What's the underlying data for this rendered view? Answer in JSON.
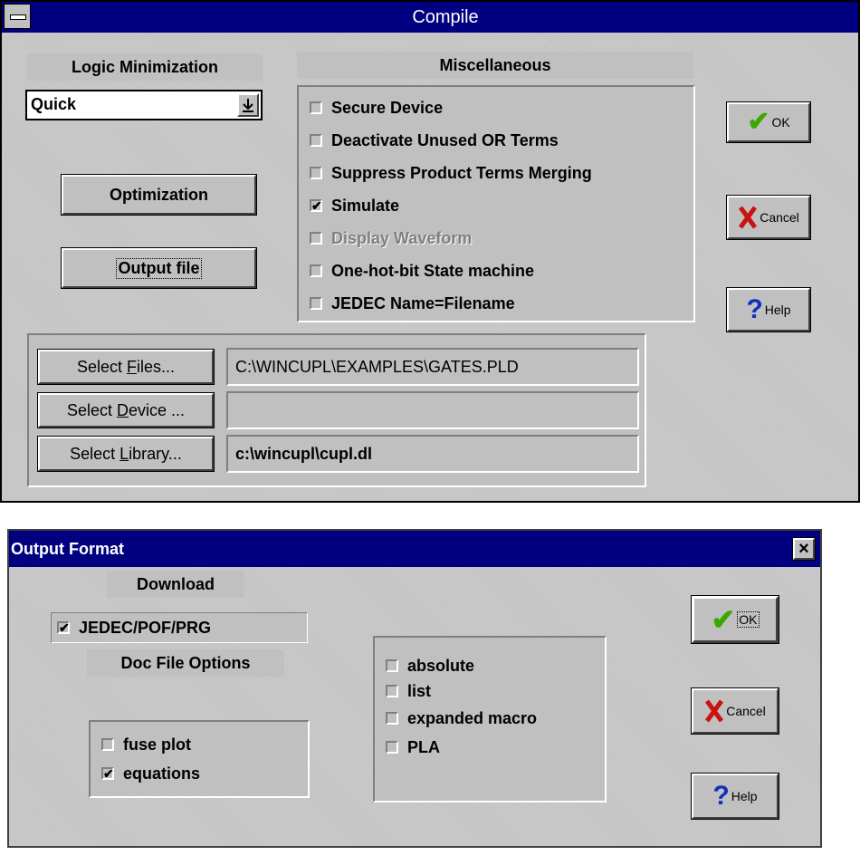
{
  "compile": {
    "title": "Compile",
    "logic_min_label": "Logic Minimization",
    "logic_min_value": "Quick",
    "misc_label": "Miscellaneous",
    "optimization_button": "Optimization",
    "output_file_button": "Output file",
    "options": [
      {
        "label": "Secure Device",
        "checked": false,
        "enabled": true
      },
      {
        "label": "Deactivate Unused OR Terms",
        "checked": false,
        "enabled": true
      },
      {
        "label": "Suppress Product Terms Merging",
        "checked": false,
        "enabled": true
      },
      {
        "label": "Simulate",
        "checked": true,
        "enabled": true
      },
      {
        "label": "Display Waveform",
        "checked": false,
        "enabled": false
      },
      {
        "label": "One-hot-bit State machine",
        "checked": false,
        "enabled": true
      },
      {
        "label": "JEDEC Name=Filename",
        "checked": false,
        "enabled": true
      }
    ],
    "ok_label": "OK",
    "cancel_label": "Cancel",
    "help_label": "Help",
    "select_files_pre": "Select ",
    "select_files_key": "F",
    "select_files_post": "iles...",
    "select_device_pre": "Select ",
    "select_device_key": "D",
    "select_device_post": "evice ...",
    "select_library_pre": "Select ",
    "select_library_key": "L",
    "select_library_post": "ibrary...",
    "files_value": "C:\\WINCUPL\\EXAMPLES\\GATES.PLD",
    "device_value": "",
    "library_value": "c:\\wincupl\\cupl.dl"
  },
  "output_format": {
    "title": "Output Format",
    "close_symbol": "×",
    "download_label": "Download",
    "jedec_label": "JEDEC/POF/PRG",
    "jedec_checked": true,
    "doc_file_label": "Doc File Options",
    "doc_options": [
      {
        "label": "fuse plot",
        "checked": false
      },
      {
        "label": "equations",
        "checked": true
      }
    ],
    "format_options": [
      {
        "label": "absolute",
        "checked": false
      },
      {
        "label": "list",
        "checked": false
      },
      {
        "label": "expanded macro",
        "checked": false
      },
      {
        "label": "PLA",
        "checked": false
      }
    ],
    "ok_label": "OK",
    "cancel_label": "Cancel",
    "help_label": "Help"
  },
  "check_glyph": "✔",
  "colors": {
    "titlebar": "#000080",
    "face": "#c0c0c0",
    "ok_check": "#3aa800",
    "cancel_x": "#cc1111",
    "help_q": "#1030c0"
  }
}
